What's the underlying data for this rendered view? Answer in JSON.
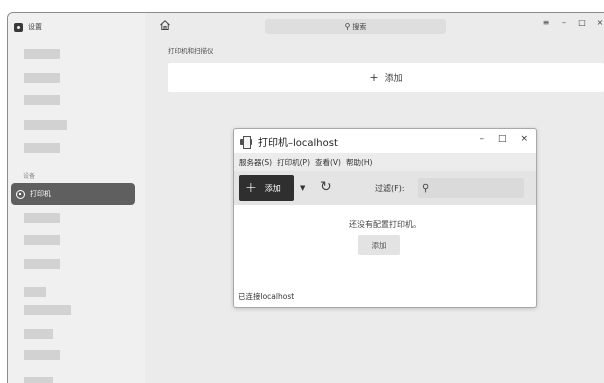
{
  "sidebar": {
    "title": "设置",
    "section_label": "设备",
    "selected_item": "打印机"
  },
  "topbar": {
    "search_text": "搜索",
    "window_controls": [
      "≡",
      "–",
      "□",
      "×"
    ]
  },
  "main": {
    "section_label": "打印机和扫描仪",
    "add_label": "添加"
  },
  "dialog": {
    "title": "打印机–localhost",
    "controls": [
      "–",
      "□",
      "×"
    ],
    "menu": [
      "服务器(S)",
      "打印机(P)",
      "查看(V)",
      "帮助(H)"
    ],
    "toolbar": {
      "add_label": "添加",
      "filter_label": "过滤(F):"
    },
    "empty_message": "还没有配置打印机。",
    "empty_add_label": "添加",
    "status": "已连接localhost"
  },
  "colors": {
    "selected_bg": "#5f5f5f",
    "dark_button": "#2f2f2f"
  }
}
